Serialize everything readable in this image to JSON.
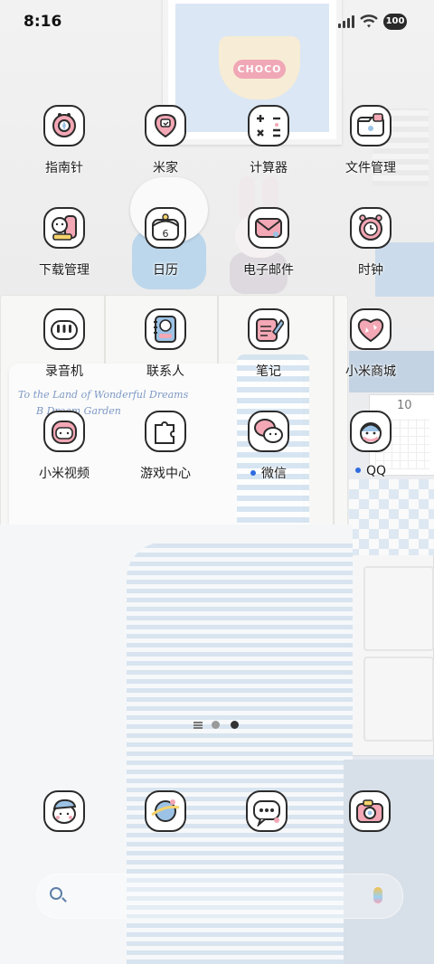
{
  "status_bar": {
    "time": "8:16",
    "battery": "100"
  },
  "wallpaper": {
    "cup_word": "CHOCO",
    "pillow_line1": "To the Land of Wonderful Dreams",
    "pillow_line2": "B    Dream Garden",
    "calendar_number": "10",
    "calendar_icon_day": "6"
  },
  "apps": [
    {
      "label": "指南针",
      "icon": "compass-icon"
    },
    {
      "label": "米家",
      "icon": "mijia-icon"
    },
    {
      "label": "计算器",
      "icon": "calculator-icon"
    },
    {
      "label": "文件管理",
      "icon": "folder-icon"
    },
    {
      "label": "下载管理",
      "icon": "download-icon"
    },
    {
      "label": "日历",
      "icon": "calendar-icon"
    },
    {
      "label": "电子邮件",
      "icon": "mail-icon"
    },
    {
      "label": "时钟",
      "icon": "clock-icon"
    },
    {
      "label": "录音机",
      "icon": "recorder-icon"
    },
    {
      "label": "联系人",
      "icon": "contacts-icon"
    },
    {
      "label": "笔记",
      "icon": "notes-icon"
    },
    {
      "label": "小米商城",
      "icon": "mistore-heart-icon"
    },
    {
      "label": "小米视频",
      "icon": "video-icon"
    },
    {
      "label": "游戏中心",
      "icon": "puzzle-icon"
    },
    {
      "label": "微信",
      "icon": "wechat-icon",
      "notification": true
    },
    {
      "label": "QQ",
      "icon": "qq-penguin-icon",
      "notification": true
    }
  ],
  "dock": [
    {
      "icon": "phone-icon"
    },
    {
      "icon": "browser-planet-icon"
    },
    {
      "icon": "messages-icon"
    },
    {
      "icon": "camera-icon"
    }
  ],
  "colors": {
    "accent_pink": "#f4a7b5",
    "accent_blue": "#bcd7ec",
    "outline": "#2b2b2b",
    "notification_dot": "#2f6bdf"
  }
}
